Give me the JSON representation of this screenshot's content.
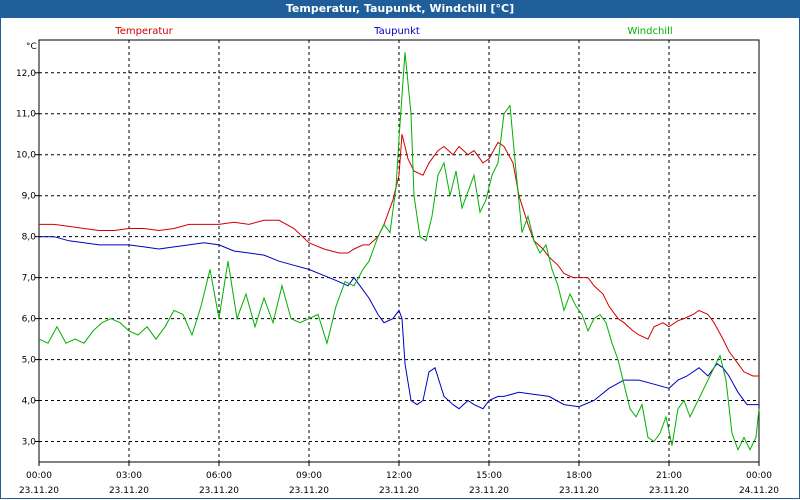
{
  "window": {
    "title": "Temperatur, Taupunkt, Windchill [°C]"
  },
  "chart_data": {
    "type": "line",
    "title": "Temperatur, Taupunkt, Windchill [°C]",
    "unit": "°C",
    "ylim": [
      2.5,
      12.8
    ],
    "y_ticks": [
      "3,0",
      "4,0",
      "5,0",
      "6,0",
      "7,0",
      "8,0",
      "9,0",
      "10,0",
      "11,0",
      "12,0"
    ],
    "xlim_hours": [
      0,
      24
    ],
    "x_ticks": [
      {
        "time": "00:00",
        "date": "23.11.20"
      },
      {
        "time": "03:00",
        "date": "23.11.20"
      },
      {
        "time": "06:00",
        "date": "23.11.20"
      },
      {
        "time": "09:00",
        "date": "23.11.20"
      },
      {
        "time": "12:00",
        "date": "23.11.20"
      },
      {
        "time": "15:00",
        "date": "23.11.20"
      },
      {
        "time": "18:00",
        "date": "23.11.20"
      },
      {
        "time": "21:00",
        "date": "23.11.20"
      },
      {
        "time": "00:00",
        "date": "24.11.20"
      }
    ],
    "grid": true,
    "legend_position": "top",
    "colors": {
      "Temperatur": "#d00000",
      "Taupunkt": "#0000c0",
      "Windchill": "#00b000",
      "title_bar": "#1f5e99"
    },
    "series": [
      {
        "name": "Temperatur",
        "x": [
          0,
          0.5,
          1,
          1.5,
          2,
          2.5,
          3,
          3.5,
          4,
          4.5,
          5,
          5.5,
          6,
          6.5,
          7,
          7.5,
          8,
          8.5,
          9,
          9.5,
          10,
          10.3,
          10.5,
          10.8,
          11,
          11.3,
          11.5,
          11.8,
          12,
          12.1,
          12.3,
          12.5,
          12.8,
          13,
          13.3,
          13.5,
          13.8,
          14,
          14.3,
          14.5,
          14.8,
          15,
          15.3,
          15.5,
          15.8,
          16,
          16.3,
          16.5,
          16.8,
          17,
          17.3,
          17.5,
          17.8,
          18,
          18.3,
          18.5,
          18.8,
          19,
          19.3,
          19.5,
          19.8,
          20,
          20.3,
          20.5,
          20.8,
          21,
          21.3,
          21.5,
          21.8,
          22,
          22.3,
          22.5,
          22.8,
          23,
          23.3,
          23.5,
          23.8,
          24
        ],
        "values": [
          8.3,
          8.3,
          8.25,
          8.2,
          8.15,
          8.15,
          8.2,
          8.2,
          8.15,
          8.2,
          8.3,
          8.3,
          8.3,
          8.35,
          8.3,
          8.4,
          8.4,
          8.2,
          7.85,
          7.7,
          7.6,
          7.6,
          7.7,
          7.8,
          7.8,
          8.0,
          8.3,
          8.9,
          9.5,
          10.5,
          9.9,
          9.6,
          9.5,
          9.8,
          10.1,
          10.2,
          10.0,
          10.2,
          10.0,
          10.1,
          9.8,
          9.9,
          10.3,
          10.2,
          9.8,
          9.0,
          8.3,
          7.9,
          7.7,
          7.5,
          7.3,
          7.1,
          7.0,
          7.0,
          7.0,
          6.8,
          6.6,
          6.3,
          6.0,
          5.9,
          5.7,
          5.6,
          5.5,
          5.8,
          5.9,
          5.8,
          5.95,
          6.0,
          6.1,
          6.2,
          6.1,
          5.9,
          5.5,
          5.2,
          4.9,
          4.7,
          4.6,
          4.6
        ]
      },
      {
        "name": "Taupunkt",
        "x": [
          0,
          0.5,
          1,
          1.5,
          2,
          2.5,
          3,
          3.5,
          4,
          4.5,
          5,
          5.5,
          6,
          6.5,
          7,
          7.5,
          8,
          8.5,
          9,
          9.5,
          10,
          10.3,
          10.5,
          10.8,
          11,
          11.3,
          11.5,
          11.8,
          12,
          12.1,
          12.2,
          12.4,
          12.6,
          12.8,
          13,
          13.2,
          13.5,
          13.8,
          14,
          14.3,
          14.5,
          14.8,
          15,
          15.3,
          15.5,
          16,
          16.5,
          17,
          17.5,
          18,
          18.5,
          19,
          19.5,
          20,
          20.5,
          21,
          21.3,
          21.6,
          22,
          22.3,
          22.6,
          22.8,
          23,
          23.3,
          23.6,
          24
        ],
        "values": [
          8.0,
          8.0,
          7.9,
          7.85,
          7.8,
          7.8,
          7.8,
          7.75,
          7.7,
          7.75,
          7.8,
          7.85,
          7.8,
          7.65,
          7.6,
          7.55,
          7.4,
          7.3,
          7.2,
          7.05,
          6.9,
          6.8,
          7.0,
          6.7,
          6.5,
          6.1,
          5.9,
          6.0,
          6.2,
          6.0,
          4.9,
          4.0,
          3.9,
          4.0,
          4.7,
          4.8,
          4.1,
          3.9,
          3.8,
          4.0,
          3.9,
          3.8,
          4.0,
          4.1,
          4.1,
          4.2,
          4.15,
          4.1,
          3.9,
          3.85,
          4.0,
          4.3,
          4.5,
          4.5,
          4.4,
          4.3,
          4.5,
          4.6,
          4.8,
          4.6,
          4.9,
          4.8,
          4.6,
          4.2,
          3.9,
          3.9
        ]
      },
      {
        "name": "Windchill",
        "x": [
          0,
          0.3,
          0.6,
          0.9,
          1.2,
          1.5,
          1.8,
          2.1,
          2.4,
          2.7,
          3,
          3.3,
          3.6,
          3.9,
          4.2,
          4.5,
          4.8,
          5.1,
          5.4,
          5.7,
          6,
          6.3,
          6.6,
          6.9,
          7.2,
          7.5,
          7.8,
          8.1,
          8.4,
          8.7,
          9,
          9.3,
          9.6,
          9.9,
          10.2,
          10.5,
          10.8,
          11,
          11.3,
          11.5,
          11.7,
          11.9,
          12,
          12.2,
          12.4,
          12.5,
          12.7,
          12.9,
          13.1,
          13.3,
          13.5,
          13.7,
          13.9,
          14.1,
          14.3,
          14.5,
          14.7,
          14.9,
          15.1,
          15.3,
          15.5,
          15.7,
          15.9,
          16.1,
          16.3,
          16.5,
          16.7,
          16.9,
          17.1,
          17.3,
          17.5,
          17.7,
          17.9,
          18.1,
          18.3,
          18.5,
          18.7,
          18.9,
          19.1,
          19.3,
          19.5,
          19.7,
          19.9,
          20.1,
          20.3,
          20.5,
          20.7,
          20.9,
          21.1,
          21.3,
          21.5,
          21.7,
          21.9,
          22.1,
          22.3,
          22.5,
          22.7,
          22.9,
          23.1,
          23.3,
          23.5,
          23.7,
          23.9,
          24
        ],
        "values": [
          5.5,
          5.4,
          5.8,
          5.4,
          5.5,
          5.4,
          5.7,
          5.9,
          6.0,
          5.9,
          5.7,
          5.6,
          5.8,
          5.5,
          5.8,
          6.2,
          6.1,
          5.6,
          6.3,
          7.2,
          6.0,
          7.4,
          6.0,
          6.6,
          5.8,
          6.5,
          5.9,
          6.8,
          6.0,
          5.9,
          6.0,
          6.1,
          5.4,
          6.3,
          6.9,
          6.8,
          7.2,
          7.4,
          8.0,
          8.3,
          8.1,
          9.2,
          10.4,
          12.5,
          11.0,
          9.0,
          8.0,
          7.9,
          8.5,
          9.5,
          9.8,
          9.0,
          9.6,
          8.7,
          9.1,
          9.5,
          8.6,
          8.9,
          9.5,
          9.8,
          11.0,
          11.2,
          9.6,
          8.1,
          8.5,
          7.9,
          7.6,
          7.8,
          7.2,
          6.8,
          6.2,
          6.6,
          6.3,
          6.1,
          5.7,
          6.0,
          6.1,
          5.9,
          5.4,
          5.0,
          4.4,
          3.8,
          3.6,
          3.9,
          3.1,
          3.0,
          3.2,
          3.6,
          2.9,
          3.8,
          4.0,
          3.6,
          3.9,
          4.2,
          4.5,
          4.8,
          5.1,
          4.5,
          3.2,
          2.8,
          3.1,
          2.8,
          3.1,
          3.8
        ]
      }
    ]
  }
}
